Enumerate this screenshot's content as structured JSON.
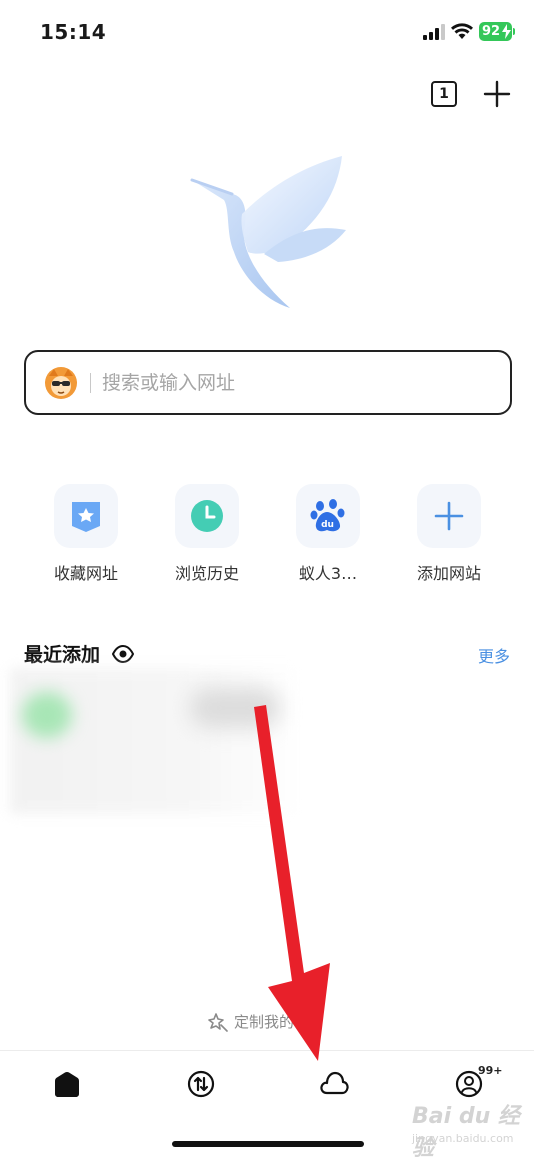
{
  "status_bar": {
    "time": "15:14",
    "battery": "92"
  },
  "header": {
    "tab_count": "1"
  },
  "search": {
    "placeholder": "搜索或输入网址"
  },
  "shortcuts": [
    {
      "label": "收藏网址",
      "icon": "bookmark-icon",
      "color": "#5b9cf0"
    },
    {
      "label": "浏览历史",
      "icon": "clock-icon",
      "color": "#3ec9b0"
    },
    {
      "label": "蚁人3…",
      "icon": "baidu-paw-icon",
      "color": "#2f6fe4"
    },
    {
      "label": "添加网站",
      "icon": "plus-icon",
      "color": "#4a90e2"
    }
  ],
  "recent": {
    "title": "最近添加",
    "more": "更多"
  },
  "customize": {
    "label": "定制我的"
  },
  "tabbar": {
    "badge": "99+"
  },
  "watermark": {
    "text": "Bai du 经验",
    "sub": "jingyan.baidu.com"
  }
}
